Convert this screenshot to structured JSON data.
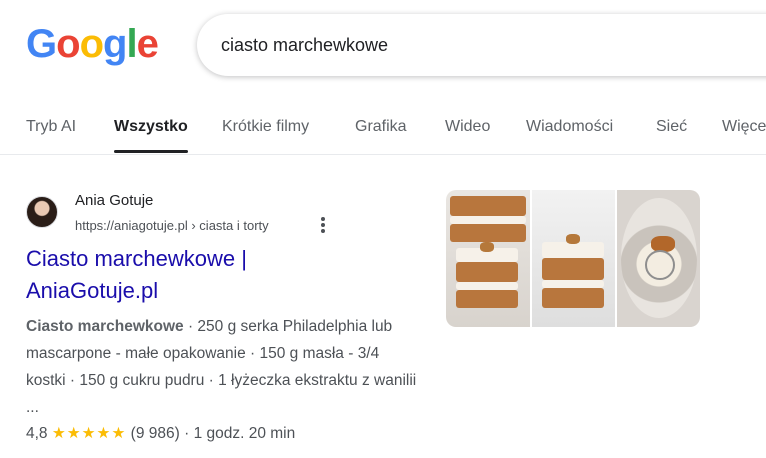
{
  "logo": {
    "text": [
      "G",
      "o",
      "o",
      "g",
      "l",
      "e"
    ],
    "colors": [
      "#4285F4",
      "#EA4335",
      "#FBBC05",
      "#4285F4",
      "#34A853",
      "#EA4335"
    ]
  },
  "search": {
    "query": "ciasto marchewkowe"
  },
  "tabs": [
    {
      "label": "Tryb AI"
    },
    {
      "label": "Wszystko"
    },
    {
      "label": "Krótkie filmy"
    },
    {
      "label": "Grafika"
    },
    {
      "label": "Wideo"
    },
    {
      "label": "Wiadomości"
    },
    {
      "label": "Sieć"
    },
    {
      "label": "Więce"
    }
  ],
  "active_tab": "Wszystko",
  "result": {
    "site_name": "Ania Gotuje",
    "url": "https://aniagotuje.pl › ciasta i torty",
    "title_line1": "Ciasto marchewkowe |",
    "title_line2": "AniaGotuje.pl",
    "snippet_bold": "Ciasto marchewkowe",
    "snippet_rest": " · 250 g serka Philadelphia lub mascarpone - małe opakowanie · 150 g masła - 3/4 kostki · 150 g cukru pudru · 1 łyżeczka ekstraktu z wanilii ...",
    "rating_value": "4,8",
    "stars": "★★★★★",
    "rating_count": "(9 986)",
    "time": "· 1 godz. 20 min"
  },
  "colors": {
    "link": "#1a0dab",
    "star": "#fbbc04",
    "text_secondary": "#4d5156"
  },
  "icons": [
    "avatar",
    "more-vert-icon",
    "star-icon"
  ]
}
